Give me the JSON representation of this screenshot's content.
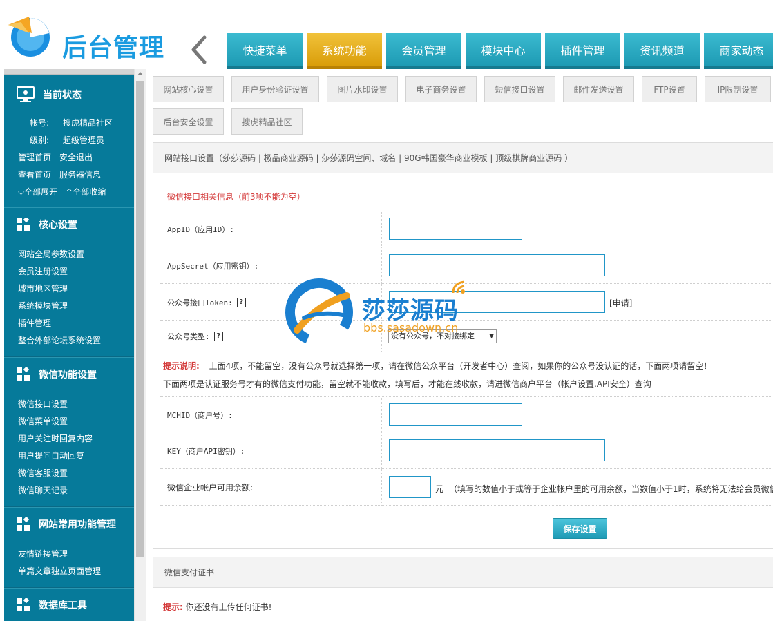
{
  "header": {
    "logo_text": "后台管理",
    "nav": [
      {
        "label": "快捷菜单",
        "active": false
      },
      {
        "label": "系统功能",
        "active": true
      },
      {
        "label": "会员管理",
        "active": false
      },
      {
        "label": "模块中心",
        "active": false
      },
      {
        "label": "插件管理",
        "active": false
      },
      {
        "label": "资讯频道",
        "active": false
      },
      {
        "label": "商家动态",
        "active": false
      }
    ]
  },
  "sidebar": {
    "status": {
      "title": "当前状态",
      "account_label": "帐号:",
      "account_value": "搜虎精品社区",
      "level_label": "级别:",
      "level_value": "超级管理员",
      "links": [
        "管理首页",
        "安全退出",
        "查看首页",
        "服务器信息",
        "全部展开",
        "全部收缩"
      ]
    },
    "sections": [
      {
        "title": "核心设置",
        "items": [
          "网站全局参数设置",
          "会员注册设置",
          "城市地区管理",
          "系统模块管理",
          "插件管理",
          "整合外部论坛系统设置"
        ]
      },
      {
        "title": "微信功能设置",
        "items": [
          "微信接口设置",
          "微信菜单设置",
          "用户关注时回复内容",
          "用户提问自动回复",
          "微信客服设置",
          "微信聊天记录"
        ]
      },
      {
        "title": "网站常用功能管理",
        "items": [
          "友情链接管理",
          "单篇文章独立页面管理"
        ]
      },
      {
        "title": "数据库工具",
        "items": []
      }
    ]
  },
  "subtabs": [
    "网站核心设置",
    "用户身份验证设置",
    "图片水印设置",
    "电子商务设置",
    "短信接口设置",
    "邮件发送设置",
    "FTP设置",
    "IP限制设置",
    "后台安全设置",
    "搜虎精品社区"
  ],
  "panel": {
    "title": "网站接口设置（莎莎源码 | 极品商业源码 | 莎莎源码空间、域名 | 90G韩国豪华商业模板 | 顶级棋牌商业源码 ）",
    "red_title": "微信接口相关信息（前3项不能为空）",
    "fields": {
      "appid_label": "AppID（应用ID）:",
      "appsecret_label": "AppSecret（应用密钥）:",
      "token_label": "公众号接口Token:",
      "token_apply": "[申请]",
      "type_label": "公众号类型:",
      "type_selected": "没有公众号，不对接绑定",
      "mchid_label": "MCHID（商户号）:",
      "key_label": "KEY（商户API密钥）:",
      "balance_label": "微信企业帐户可用余额:",
      "balance_unit": "元",
      "balance_note": "（填写的数值小于或等于企业帐户里的可用余额，当数值小于1时，系统将无法给会员微信"
    },
    "help_mark": "?",
    "note1_prefix": "提示说明:",
    "note1": "上面4项，不能留空，没有公众号就选择第一项，请在微信公众平台（开发者中心）查阅，如果你的公众号没认证的话，下面两项请留空！",
    "note2": "下面两项是认证服务号才有的微信支付功能，留空就不能收款，填写后，才能在线收款，请进微信商户平台（帐户设置.API安全）查询",
    "save_label": "保存设置"
  },
  "cert_panel": {
    "title": "微信支付证书",
    "tip_label": "提示:",
    "tip_text": "你还没有上传任何证书!"
  },
  "watermark": {
    "name": "莎莎源码",
    "url": "bbs.sasadown.cn"
  },
  "colors": {
    "nav_teal": "#1d9ab3",
    "nav_active": "#e0a515",
    "sidebar_bg": "#067a9a",
    "alert_red": "#d43a3a"
  }
}
